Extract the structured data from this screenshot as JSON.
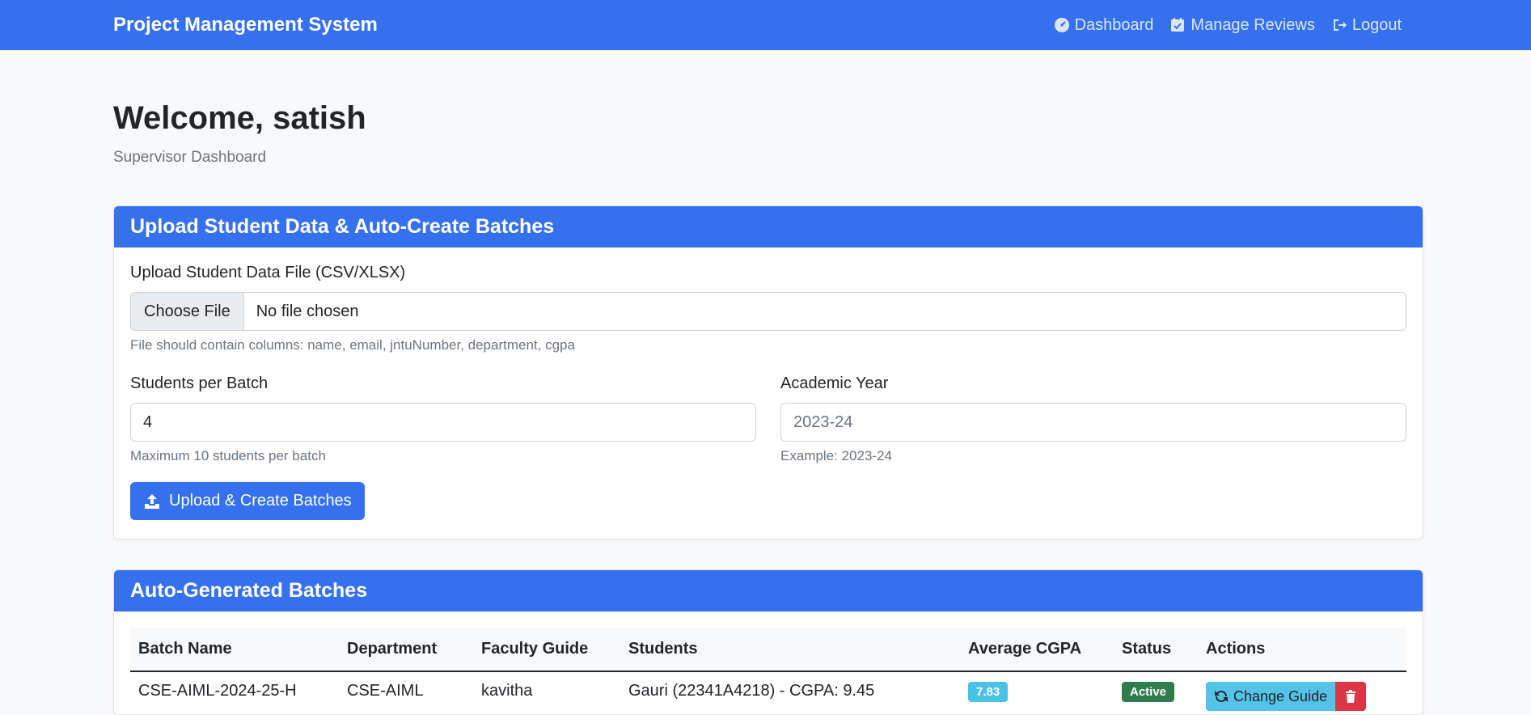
{
  "navbar": {
    "brand": "Project Management System",
    "links": [
      {
        "label": "Dashboard",
        "icon": "gauge-icon"
      },
      {
        "label": "Manage Reviews",
        "icon": "calendar-check-icon"
      },
      {
        "label": "Logout",
        "icon": "logout-icon"
      }
    ]
  },
  "header": {
    "welcome": "Welcome, satish",
    "subtitle": "Supervisor Dashboard"
  },
  "upload": {
    "title": "Upload Student Data & Auto-Create Batches",
    "file_label": "Upload Student Data File (CSV/XLSX)",
    "choose_file": "Choose File",
    "no_file": "No file chosen",
    "file_help": "File should contain columns: name, email, jntuNumber, department, cgpa",
    "batch_label": "Students per Batch",
    "batch_value": "4",
    "batch_help": "Maximum 10 students per batch",
    "year_label": "Academic Year",
    "year_placeholder": "2023-24",
    "year_help": "Example: 2023-24",
    "submit": "Upload & Create Batches"
  },
  "batches": {
    "title": "Auto-Generated Batches",
    "columns": [
      "Batch Name",
      "Department",
      "Faculty Guide",
      "Students",
      "Average CGPA",
      "Status",
      "Actions"
    ],
    "rows": [
      {
        "batch_name": "CSE-AIML-2024-25-H",
        "department": "CSE-AIML",
        "guide": "kavitha",
        "students": "Gauri (22341A4218) - CGPA: 9.45",
        "avg_cgpa": "7.83",
        "status": "Active",
        "change_guide": "Change Guide"
      }
    ]
  },
  "colors": {
    "primary": "#3570ee",
    "info": "#4ac2e6",
    "success": "#2f7d4c",
    "danger": "#dc3545"
  }
}
